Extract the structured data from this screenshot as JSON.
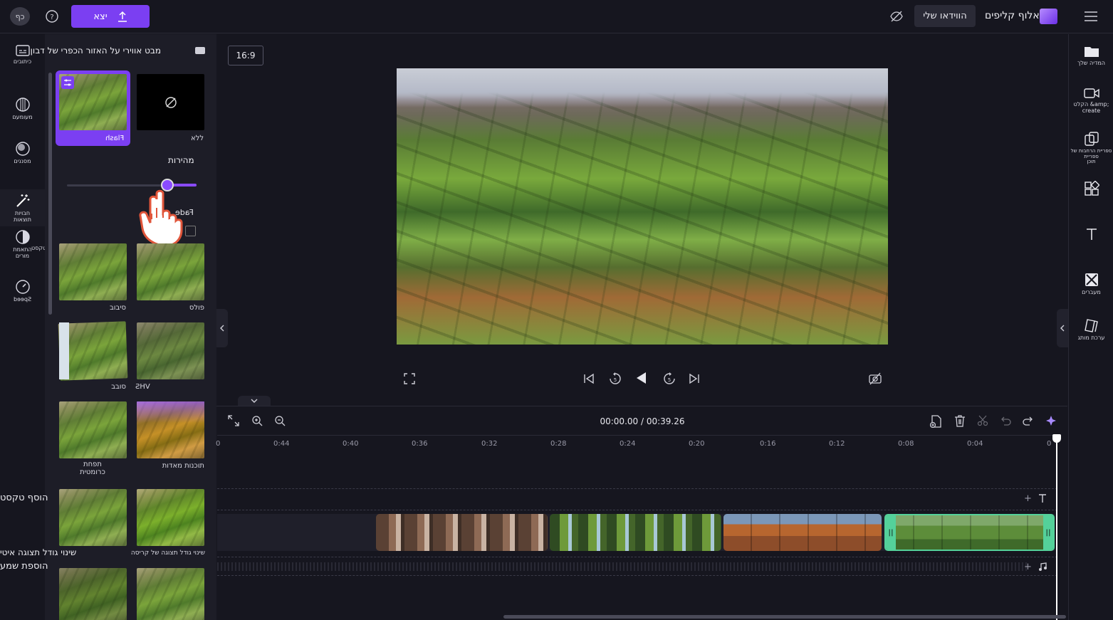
{
  "header": {
    "app_name": "אלוף קליפים",
    "my_videos": "הווידאו שלי",
    "export_label": "יצא",
    "avatar_initials": "כף"
  },
  "left_rail": {
    "items": [
      {
        "label": "כיתובים"
      },
      {
        "label": "מעומעם"
      },
      {
        "label": "מסננים"
      },
      {
        "label": "חבויות\nתוצאות"
      },
      {
        "label": "התאמת\nמורים"
      },
      {
        "label": "Speed"
      }
    ]
  },
  "panel": {
    "title": "מבט אווירי על האזור הכפרי של דבון",
    "options": [
      {
        "label": "ללא"
      },
      {
        "label": "Flash"
      }
    ],
    "speed_label": "מהירות",
    "speed_fraction": 0.77,
    "fade_label": "Fade",
    "effects": [
      {
        "label": "פולס"
      },
      {
        "label": "סיבוב"
      },
      {
        "label": "VHS"
      },
      {
        "label": "סובב"
      },
      {
        "label": "תוכנות מאדות"
      },
      {
        "label": "תפחת\nכרומטית"
      },
      {
        "label": "שינוי גודל תצוגה של קריסה"
      },
      {
        "label": ""
      }
    ]
  },
  "preview": {
    "aspect_ratio": "16:9"
  },
  "right_rail": {
    "items": [
      {
        "label": "המדיה שלך"
      },
      {
        "label": "הקלט &amp;\ncreate"
      },
      {
        "label": "ספריית הרחבות של ספריית\nתוכן"
      },
      {
        "label": ""
      },
      {
        "label": ""
      },
      {
        "label": "מעברים"
      },
      {
        "label": "ערכת מותג"
      }
    ]
  },
  "timeline": {
    "time_display": "00:00.00 / 00:39.26",
    "ticks": [
      "0",
      "0:04",
      "0:08",
      "0:12",
      "0:16",
      "0:20",
      "0:24",
      "0:28",
      "0:32",
      "0:36",
      "0:40",
      "0:44",
      "0"
    ],
    "add_text": "הוסף טקסט",
    "add_audio": "הוספת שמע",
    "zoom_label": "שינוי גודל תצוגה איטי"
  },
  "side_labels": {
    "text": "טקסט"
  },
  "colors": {
    "accent": "#7b3ff2",
    "background": "#16161f",
    "panel": "#1d1d27",
    "selected_clip": "#54d19a"
  }
}
